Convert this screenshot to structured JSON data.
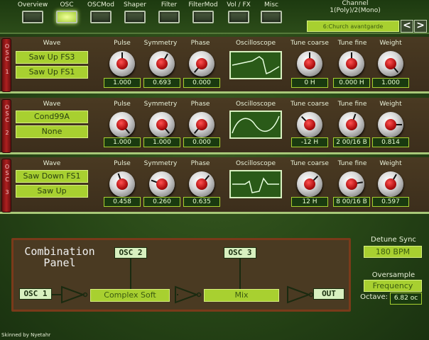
{
  "tabs": [
    {
      "label": "Overview",
      "active": false
    },
    {
      "label": "OSC",
      "active": true
    },
    {
      "label": "OSCMod",
      "active": false
    },
    {
      "label": "Shaper",
      "active": false
    },
    {
      "label": "Filter",
      "active": false
    },
    {
      "label": "FilterMod",
      "active": false
    },
    {
      "label": "Vol / FX",
      "active": false
    },
    {
      "label": "Misc",
      "active": false
    }
  ],
  "channel": {
    "title": "Channel",
    "mode": "1(Poly)/2(Mono)",
    "preset": "6:Church avantgarde",
    "prev": "<",
    "next": ">"
  },
  "headers": {
    "wave": "Wave",
    "pulse": "Pulse",
    "symmetry": "Symmetry",
    "phase": "Phase",
    "oscilloscope": "Oscilloscope",
    "tune_coarse": "Tune coarse",
    "tune_fine": "Tune fine",
    "weight": "Weight"
  },
  "oscillators": [
    {
      "name": "OSC 1",
      "wave1": "Saw Up FS3",
      "wave2": "Saw Up FS1",
      "pulse": "1.000",
      "symmetry": "0.693",
      "phase": "0.000",
      "tune_coarse": "0 H",
      "tune_fine": "0.000 H",
      "weight": "1.000"
    },
    {
      "name": "OSC 2",
      "wave1": "Cond99A",
      "wave2": "None",
      "pulse": "1.000",
      "symmetry": "1.000",
      "phase": "0.000",
      "tune_coarse": "-12 H",
      "tune_fine": "2 00/16 B",
      "weight": "0.814"
    },
    {
      "name": "OSC 3",
      "wave1": "Saw Down FS1",
      "wave2": "Saw Up",
      "pulse": "0.458",
      "symmetry": "0.260",
      "phase": "0.635",
      "tune_coarse": "12 H",
      "tune_fine": "8 00/16 B",
      "weight": "0.597"
    }
  ],
  "combination": {
    "title_line1": "Combination",
    "title_line2": "Panel",
    "osc1": "OSC 1",
    "osc2": "OSC 2",
    "osc3": "OSC 3",
    "mode12": "Complex Soft",
    "mode3": "Mix",
    "out": "OUT"
  },
  "detune_sync": {
    "label": "Detune Sync",
    "value": "180 BPM"
  },
  "oversample": {
    "label": "Oversample",
    "value": "Frequency",
    "octave_label": "Octave:",
    "octave_value": "6.82 oc"
  },
  "credits": "Skinned by Nyetahr",
  "colors": {
    "accent": "#a8d030",
    "panel": "#4a3a22",
    "knob_red": "#b01010"
  }
}
